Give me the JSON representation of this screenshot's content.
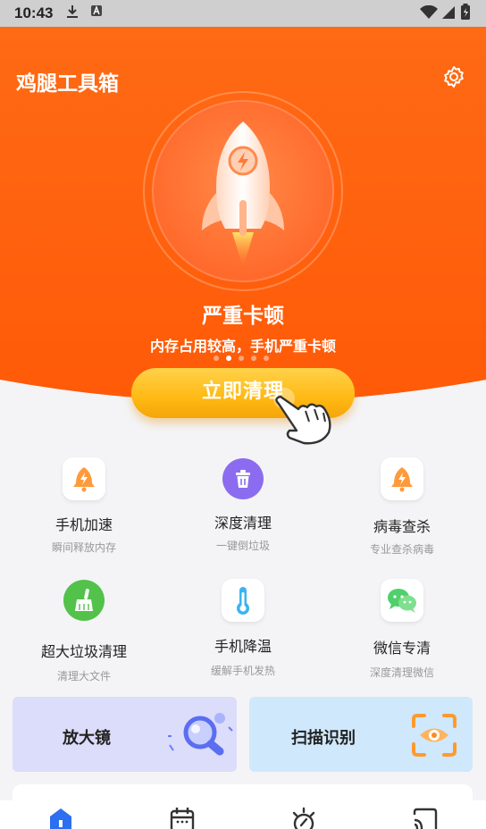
{
  "statusbar": {
    "time": "10:43"
  },
  "header": {
    "app_title": "鸡腿工具箱"
  },
  "hero": {
    "status_title": "严重卡顿",
    "status_sub": "内存占用较高，手机严重卡顿",
    "pager": {
      "count": 5,
      "active_index": 1
    }
  },
  "primary_button": {
    "label": "立即清理"
  },
  "features": [
    {
      "title": "手机加速",
      "sub": "瞬间释放内存",
      "icon": "rocket-bell-icon"
    },
    {
      "title": "深度清理",
      "sub": "一键倒垃圾",
      "icon": "trash-icon"
    },
    {
      "title": "病毒查杀",
      "sub": "专业查杀病毒",
      "icon": "rocket-bell-icon"
    },
    {
      "title": "超大垃圾清理",
      "sub": "清理大文件",
      "icon": "broom-icon"
    },
    {
      "title": "手机降温",
      "sub": "缓解手机发热",
      "icon": "thermometer-icon"
    },
    {
      "title": "微信专清",
      "sub": "深度清理微信",
      "icon": "wechat-icon"
    }
  ],
  "cards": {
    "left": {
      "label": "放大镜",
      "icon": "magnifier-icon"
    },
    "right": {
      "label": "扫描识别",
      "icon": "scan-eye-icon"
    }
  },
  "colors": {
    "hero": "#ff5e0e",
    "button": "#ffbb18",
    "card_left": "#dcdcfb",
    "card_right": "#cfe8fc"
  }
}
